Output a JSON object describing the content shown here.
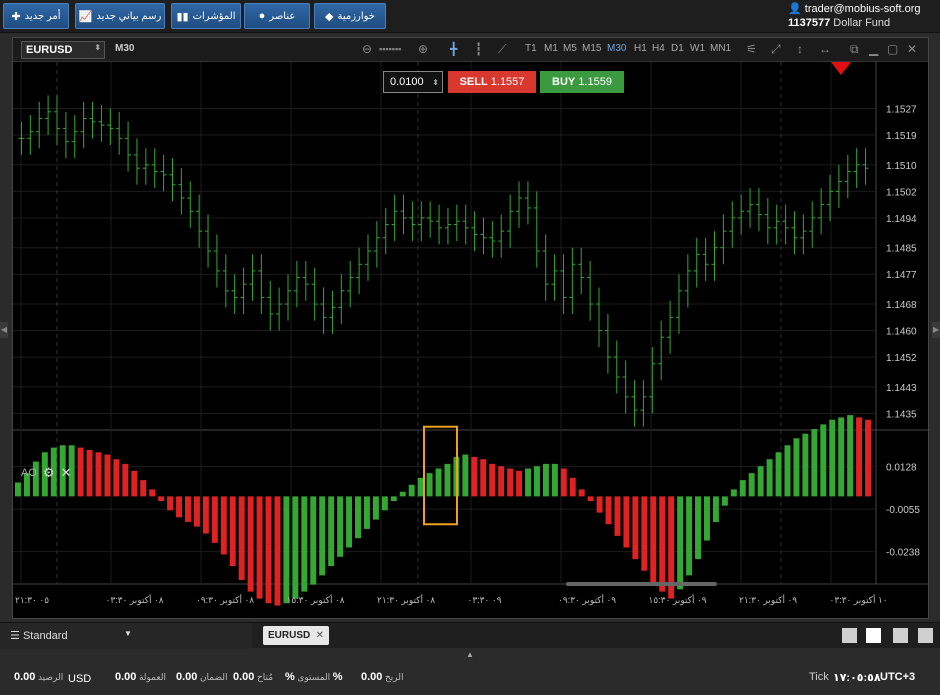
{
  "topbar": {
    "buttons": [
      {
        "label": "أمر جديد",
        "icon": "plus-icon"
      },
      {
        "label": "رسم بياني جديد",
        "icon": "chart-icon"
      },
      {
        "label": "المؤشرات",
        "icon": "bars-icon"
      },
      {
        "label": "عناصر",
        "icon": "shapes-icon"
      },
      {
        "label": "خوارزمية",
        "icon": "diamond-icon"
      }
    ],
    "account_user": "trader@mobius-soft.org",
    "account_id": "1137577",
    "account_fund": "Dollar Fund"
  },
  "chart_toolbar": {
    "symbol": "EURUSD",
    "timeframe_label": "M30",
    "timeframes": [
      "T1",
      "M1",
      "M5",
      "M15",
      "M30",
      "H1",
      "H4",
      "D1",
      "W1",
      "MN1"
    ],
    "active_timeframe": "M30"
  },
  "order": {
    "quantity": "0.0100",
    "sell_label": "SELL",
    "sell_price": "1.1557",
    "buy_label": "BUY",
    "buy_price": "1.1559"
  },
  "indicator": {
    "label": "AO"
  },
  "colors": {
    "up": "#33a833",
    "down": "#e02222",
    "buy": "#3b9a3f",
    "sell": "#d9382f",
    "highlight": "#f0a020"
  },
  "chart_data": [
    {
      "type": "ohlc",
      "symbol": "EURUSD",
      "price_ticks": [
        "1.1527",
        "1.1519",
        "1.1510",
        "1.1502",
        "1.1494",
        "1.1485",
        "1.1477",
        "1.1468",
        "1.1460",
        "1.1452",
        "1.1443",
        "1.1435"
      ],
      "ylim": [
        1.143,
        1.1535
      ],
      "close_series": [
        1.1518,
        1.152,
        1.1524,
        1.1526,
        1.1521,
        1.1517,
        1.152,
        1.1524,
        1.1523,
        1.1522,
        1.1521,
        1.1518,
        1.1513,
        1.1509,
        1.151,
        1.1508,
        1.1507,
        1.1504,
        1.15,
        1.1496,
        1.149,
        1.1484,
        1.1478,
        1.1472,
        1.147,
        1.1474,
        1.1478,
        1.147,
        1.1465,
        1.1468,
        1.1472,
        1.1476,
        1.1474,
        1.1468,
        1.1464,
        1.1467,
        1.1472,
        1.1476,
        1.148,
        1.1484,
        1.1488,
        1.1492,
        1.1496,
        1.1494,
        1.1492,
        1.1494,
        1.1493,
        1.1491,
        1.1492,
        1.1493,
        1.1491,
        1.1489,
        1.1488,
        1.1487,
        1.149,
        1.1496,
        1.15,
        1.1497,
        1.1484,
        1.1474,
        1.1478,
        1.147,
        1.148,
        1.1476,
        1.1468,
        1.146,
        1.1452,
        1.1446,
        1.144,
        1.1436,
        1.144,
        1.145,
        1.1458,
        1.1464,
        1.1472,
        1.1478,
        1.1483,
        1.148,
        1.1485,
        1.149,
        1.1494,
        1.1496,
        1.1498,
        1.1495,
        1.1491,
        1.1493,
        1.1491,
        1.1488,
        1.149,
        1.1494,
        1.1498,
        1.1502,
        1.1505,
        1.1508,
        1.151,
        1.1509
      ]
    },
    {
      "type": "bar",
      "name": "AO",
      "value_ticks": [
        "0.0128",
        "-0.0055",
        "-0.0238"
      ],
      "ylim": [
        -0.036,
        0.026
      ],
      "values": [
        0.006,
        0.01,
        0.015,
        0.019,
        0.021,
        0.022,
        0.022,
        0.021,
        0.02,
        0.019,
        0.018,
        0.016,
        0.014,
        0.011,
        0.007,
        0.003,
        -0.002,
        -0.006,
        -0.009,
        -0.011,
        -0.013,
        -0.016,
        -0.02,
        -0.025,
        -0.03,
        -0.036,
        -0.041,
        -0.044,
        -0.046,
        -0.047,
        -0.046,
        -0.044,
        -0.041,
        -0.038,
        -0.034,
        -0.03,
        -0.026,
        -0.022,
        -0.018,
        -0.014,
        -0.01,
        -0.006,
        -0.002,
        0.002,
        0.005,
        0.008,
        0.01,
        0.012,
        0.014,
        0.017,
        0.018,
        0.017,
        0.016,
        0.014,
        0.013,
        0.012,
        0.011,
        0.012,
        0.013,
        0.014,
        0.014,
        0.012,
        0.008,
        0.003,
        -0.002,
        -0.007,
        -0.012,
        -0.017,
        -0.022,
        -0.027,
        -0.032,
        -0.037,
        -0.041,
        -0.044,
        -0.04,
        -0.034,
        -0.027,
        -0.019,
        -0.011,
        -0.004,
        0.003,
        0.007,
        0.01,
        0.013,
        0.016,
        0.019,
        0.022,
        0.025,
        0.027,
        0.029,
        0.031,
        0.033,
        0.034,
        0.035,
        0.034,
        0.033
      ]
    }
  ],
  "time_axis": [
    "٠٥ ٢١:٣٠",
    "٠٨ أكتوبر ٠٣:٣٠",
    "٠٨ أكتوبر ٠٩:٣٠",
    "٠٨ أكتوبر ١٥:٣٠",
    "٠٨ أكتوبر ٢١:٣٠",
    "٠٩ ٠٣:٣٠",
    "٠٩ أكتوبر ٠٩:٣٠",
    "٠٩ أكتوبر ١٥:٣٠",
    "٠٩ أكتوبر ٢١:٣٠",
    "١٠ أكتوبر ٠٣:٣٠"
  ],
  "bottom": {
    "layout_select": "Standard",
    "tab": "EURUSD"
  },
  "status": {
    "balance_label": "الرصيد",
    "balance_value": "0.00",
    "currency": "USD",
    "commission_label": "العمولة",
    "commission_value": "0.00",
    "margin_label": "الضمان",
    "margin_value": "0.00",
    "free_label": "مُتاح",
    "free_value": "0.00",
    "level_label": "المستوى",
    "level_value": "%",
    "profit_label": "الربح",
    "profit_value": "0.00",
    "tick_label": "Tick",
    "clock": "١٧:٠٥:٥٨",
    "timezone": "UTC+3"
  }
}
